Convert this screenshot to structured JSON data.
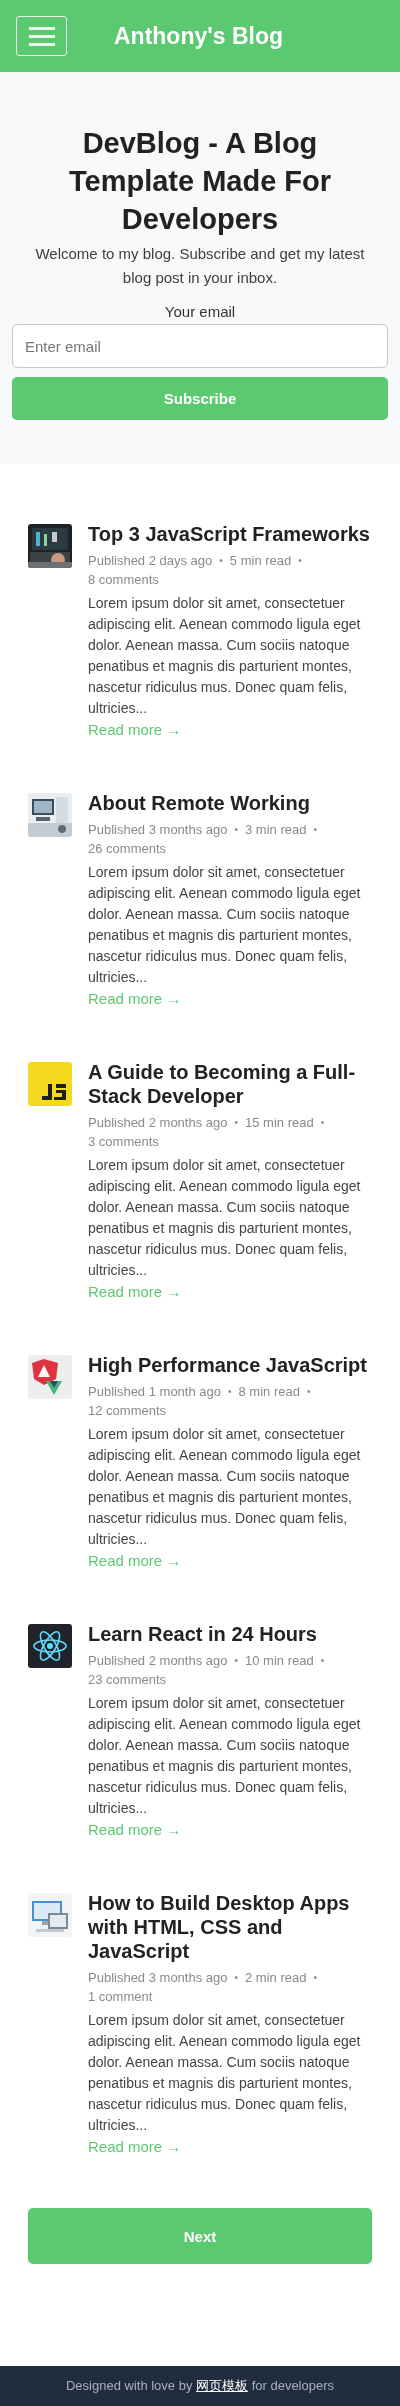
{
  "header": {
    "title": "Anthony's Blog"
  },
  "hero": {
    "title": "DevBlog - A Blog Template Made For Developers",
    "intro": "Welcome to my blog. Subscribe and get my latest blog post in your inbox.",
    "email_label": "Your email",
    "email_placeholder": "Enter email",
    "subscribe_button": "Subscribe"
  },
  "posts": [
    {
      "title": "Top 3 JavaScript Frameworks",
      "meta": [
        "Published 2 days ago",
        "•",
        "5 min read",
        "•",
        "8 comments"
      ],
      "excerpt": "Lorem ipsum dolor sit amet, consectetuer adipiscing elit. Aenean commodo ligula eget dolor. Aenean massa. Cum sociis natoque penatibus et magnis dis parturient montes, nascetur ridiculus mus. Donec quam felis, ultricies...",
      "link": "Read more →"
    },
    {
      "title": "About Remote Working",
      "meta": [
        "Published 3 months ago",
        "•",
        "3 min read",
        "•",
        "26 comments"
      ],
      "excerpt": "Lorem ipsum dolor sit amet, consectetuer adipiscing elit. Aenean commodo ligula eget dolor. Aenean massa. Cum sociis natoque penatibus et magnis dis parturient montes, nascetur ridiculus mus. Donec quam felis, ultricies...",
      "link": "Read more →"
    },
    {
      "title": "A Guide to Becoming a Full-Stack Developer",
      "meta": [
        "Published 2 months ago",
        "•",
        "15 min read",
        "•",
        "3 comments"
      ],
      "excerpt": "Lorem ipsum dolor sit amet, consectetuer adipiscing elit. Aenean commodo ligula eget dolor. Aenean massa. Cum sociis natoque penatibus et magnis dis parturient montes, nascetur ridiculus mus. Donec quam felis, ultricies...",
      "link": "Read more →"
    },
    {
      "title": "High Performance JavaScript",
      "meta": [
        "Published 1 month ago",
        "•",
        "8 min read",
        "•",
        "12 comments"
      ],
      "excerpt": "Lorem ipsum dolor sit amet, consectetuer adipiscing elit. Aenean commodo ligula eget dolor. Aenean massa. Cum sociis natoque penatibus et magnis dis parturient montes, nascetur ridiculus mus. Donec quam felis, ultricies...",
      "link": "Read more →"
    },
    {
      "title": "Learn React in 24 Hours",
      "meta": [
        "Published 2 months ago",
        "•",
        "10 min read",
        "•",
        "23 comments"
      ],
      "excerpt": "Lorem ipsum dolor sit amet, consectetuer adipiscing elit. Aenean commodo ligula eget dolor. Aenean massa. Cum sociis natoque penatibus et magnis dis parturient montes, nascetur ridiculus mus. Donec quam felis, ultricies...",
      "link": "Read more →"
    },
    {
      "title": "How to Build Desktop Apps with HTML, CSS and JavaScript",
      "meta": [
        "Published 3 months ago",
        "•",
        "2 min read",
        "•",
        "1 comment"
      ],
      "excerpt": "Lorem ipsum dolor sit amet, consectetuer adipiscing elit. Aenean commodo ligula eget dolor. Aenean massa. Cum sociis natoque penatibus et magnis dis parturient montes, nascetur ridiculus mus. Donec quam felis, ultricies...",
      "link": "Read more →"
    }
  ],
  "pagination": {
    "next_button": "Next"
  },
  "footer": {
    "text_before": "Designed with love by",
    "link": "网页模板",
    "text_after": "for developers"
  }
}
